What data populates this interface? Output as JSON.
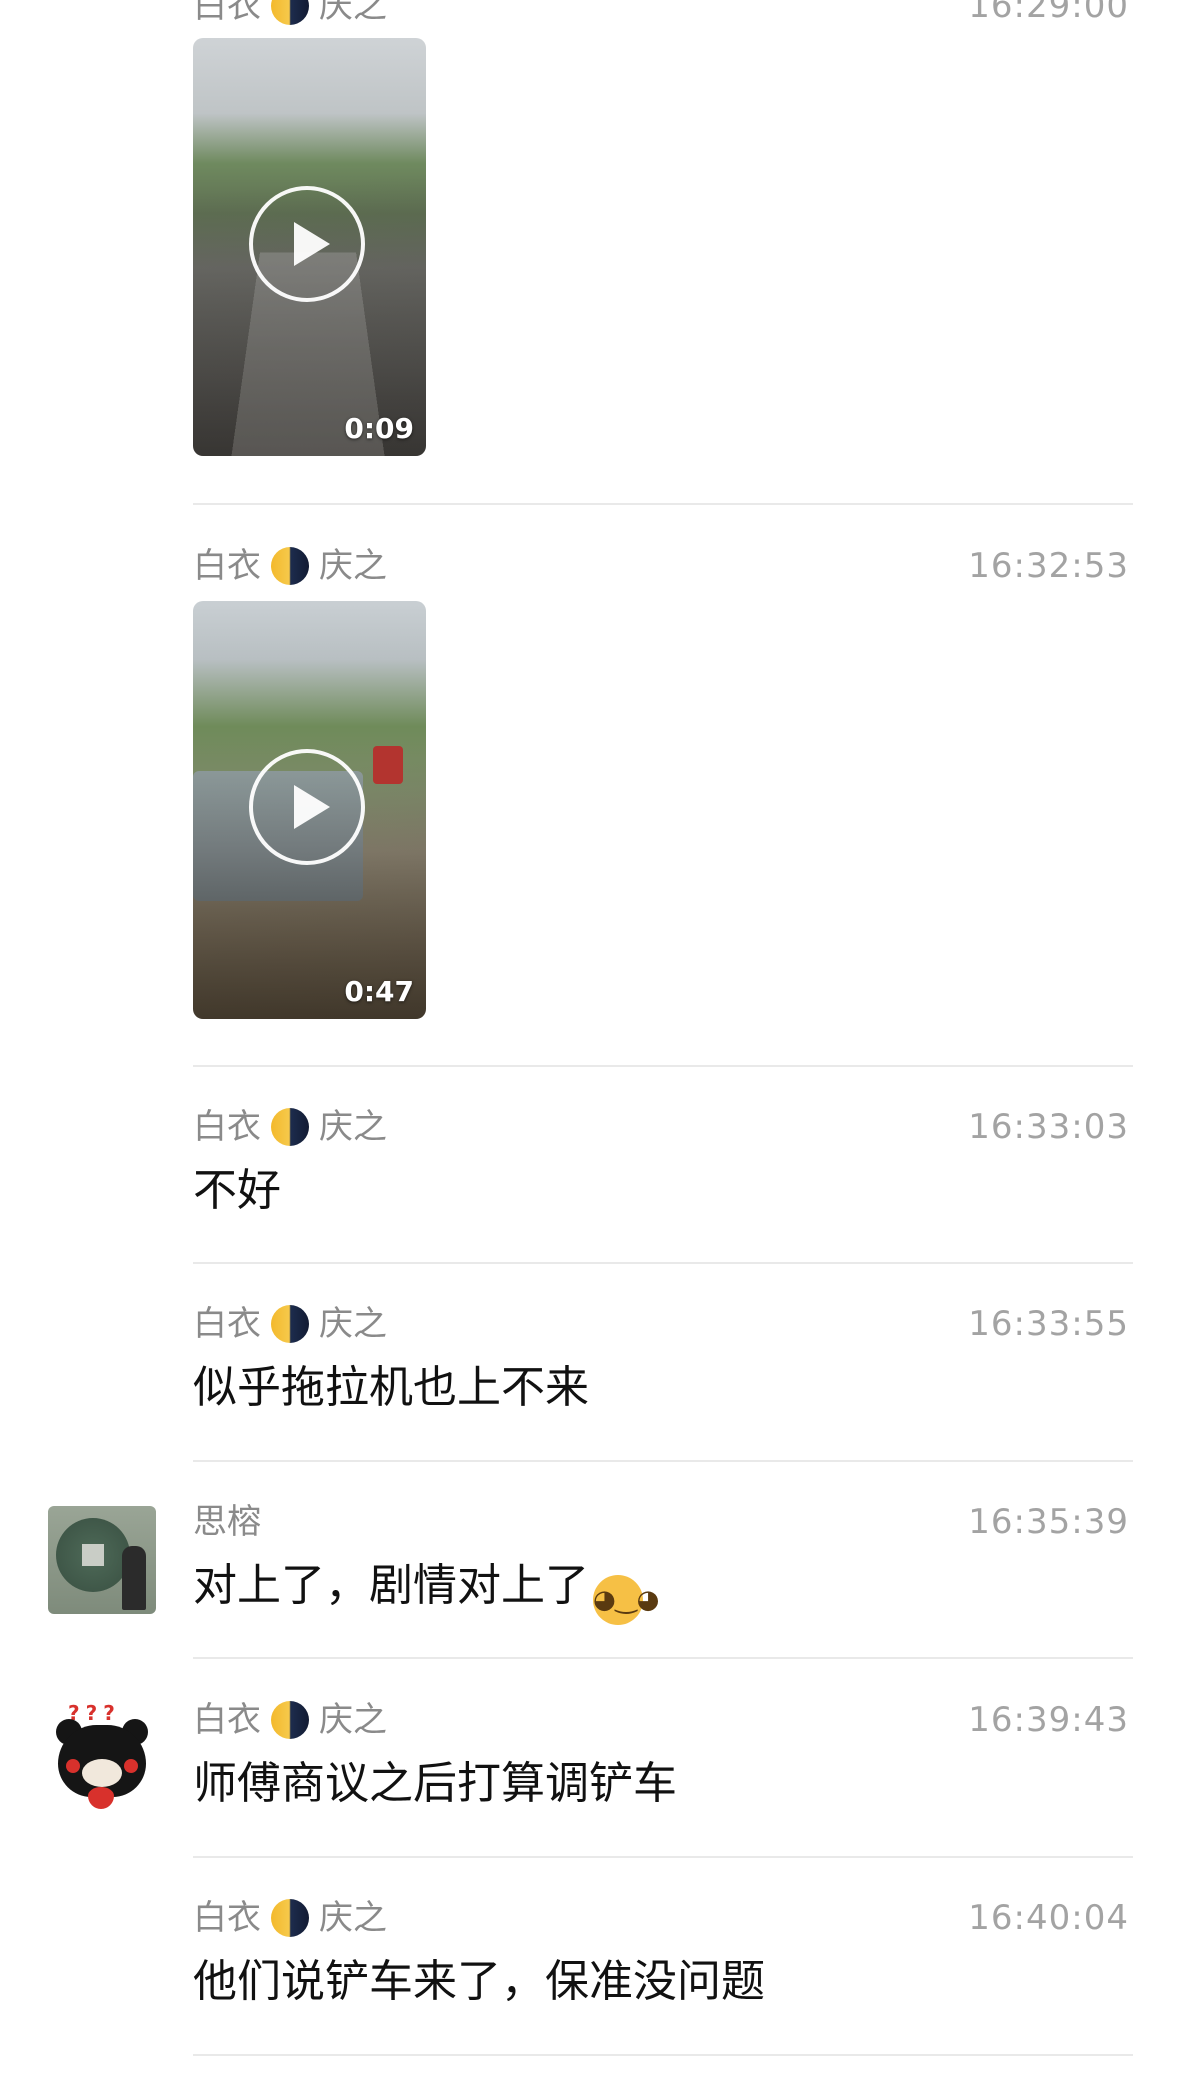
{
  "messages": [
    {
      "sender": {
        "first": "白衣",
        "second": "庆之",
        "separator_icon": "crescent-moon-icon"
      },
      "time": "16:29:00",
      "type": "video",
      "duration": "0:09"
    },
    {
      "sender": {
        "first": "白衣",
        "second": "庆之",
        "separator_icon": "crescent-moon-icon"
      },
      "time": "16:32:53",
      "type": "video",
      "duration": "0:47"
    },
    {
      "sender": {
        "first": "白衣",
        "second": "庆之",
        "separator_icon": "crescent-moon-icon"
      },
      "time": "16:33:03",
      "type": "text",
      "text": "不好"
    },
    {
      "sender": {
        "first": "白衣",
        "second": "庆之",
        "separator_icon": "crescent-moon-icon"
      },
      "time": "16:33:55",
      "type": "text",
      "text": "似乎拖拉机也上不来"
    },
    {
      "sender": {
        "name": "思榕"
      },
      "avatar_icon": "ancient-coin-avatar",
      "time": "16:35:39",
      "type": "text",
      "text": "对上了，剧情对上了",
      "emoji_icon": "doge-emoji-icon"
    },
    {
      "sender": {
        "first": "白衣",
        "second": "庆之",
        "separator_icon": "crescent-moon-icon"
      },
      "avatar_icon": "kumamon-avatar",
      "avatar_text": "???",
      "time": "16:39:43",
      "type": "text",
      "text": "师傅商议之后打算调铲车"
    },
    {
      "sender": {
        "first": "白衣",
        "second": "庆之",
        "separator_icon": "crescent-moon-icon"
      },
      "time": "16:40:04",
      "type": "text",
      "text": "他们说铲车来了，保准没问题"
    }
  ]
}
